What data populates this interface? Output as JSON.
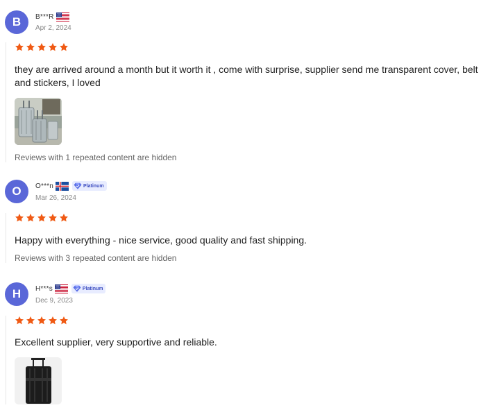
{
  "reviews": [
    {
      "initial": "B",
      "name": "B***R",
      "country_flag": "us-flag",
      "badge": "",
      "date": "Apr 2, 2024",
      "rating": 5,
      "text": "they are arrived around a month but it worth it , come with surprise, supplier send me transparent cover, belt and stickers, I loved",
      "photo": "silver-luggage-photo",
      "repeated_note": "Reviews with 1 repeated content are hidden"
    },
    {
      "initial": "O",
      "name": "O***n",
      "country_flag": "iceland-flag",
      "badge": "Platinum",
      "date": "Mar 26, 2024",
      "rating": 5,
      "text": "Happy with everything - nice service, good quality and fast shipping.",
      "repeated_note": "Reviews with 3 repeated content are hidden"
    },
    {
      "initial": "H",
      "name": "H***s",
      "country_flag": "us-flag",
      "badge": "Platinum",
      "date": "Dec 9, 2023",
      "rating": 5,
      "text": "Excellent supplier, very supportive and reliable.",
      "photo": "black-luggage-photo"
    }
  ],
  "colors": {
    "avatar": "#5a67d8",
    "star": "#f05a14",
    "badge_bg": "#e8ecff",
    "badge_text": "#3b4cc0"
  }
}
